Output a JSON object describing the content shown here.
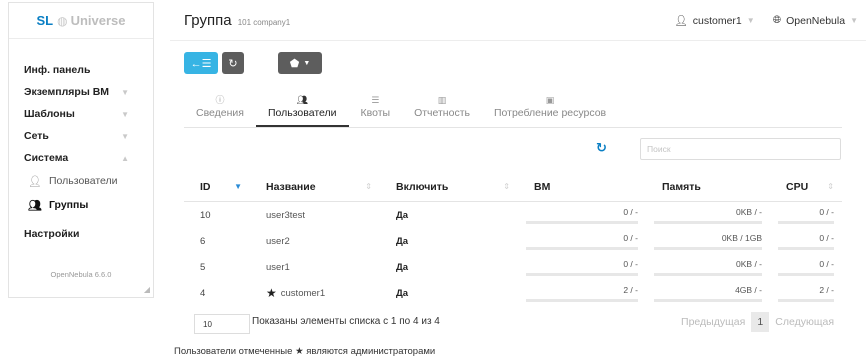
{
  "sidebar": {
    "brand_prefix": "SL",
    "brand_name": "Universe",
    "items": [
      {
        "label": "Инф. панель"
      },
      {
        "label": "Экземпляры ВМ"
      },
      {
        "label": "Шаблоны"
      },
      {
        "label": "Сеть"
      },
      {
        "label": "Система"
      }
    ],
    "subitems": [
      {
        "label": "Пользователи"
      },
      {
        "label": "Группы"
      }
    ],
    "settings_label": "Настройки",
    "version": "OpenNebula 6.6.0"
  },
  "header": {
    "title": "Группа",
    "subtitle": "101 company1",
    "user": "customer1",
    "zone": "OpenNebula"
  },
  "tabs": [
    {
      "label": "Сведения"
    },
    {
      "label": "Пользователи"
    },
    {
      "label": "Квоты"
    },
    {
      "label": "Отчетность"
    },
    {
      "label": "Потребление ресурсов"
    }
  ],
  "search": {
    "placeholder": "Поиск",
    "value": ""
  },
  "table": {
    "columns": [
      "ID",
      "Название",
      "Включить",
      "ВМ",
      "Память",
      "CPU"
    ],
    "rows": [
      {
        "id": "10",
        "name": "user3test",
        "enabled": "Да",
        "vm": "0 / -",
        "memory": "0KB / -",
        "cpu": "0 / -",
        "admin": false
      },
      {
        "id": "6",
        "name": "user2",
        "enabled": "Да",
        "vm": "0 / -",
        "memory": "0KB / 1GB",
        "cpu": "0 / -",
        "admin": false
      },
      {
        "id": "5",
        "name": "user1",
        "enabled": "Да",
        "vm": "0 / -",
        "memory": "0KB / -",
        "cpu": "0 / -",
        "admin": false
      },
      {
        "id": "4",
        "name": "customer1",
        "enabled": "Да",
        "vm": "2 / -",
        "memory": "4GB / -",
        "cpu": "2 / -",
        "admin": true
      }
    ]
  },
  "pager": {
    "page_size": "10",
    "showing": "Показаны элементы списка с 1 по 4 из 4",
    "prev": "Предыдущая",
    "current": "1",
    "next": "Следующая"
  },
  "footnote": {
    "before": "Пользователи отмеченные",
    "after": "являются администраторами"
  }
}
